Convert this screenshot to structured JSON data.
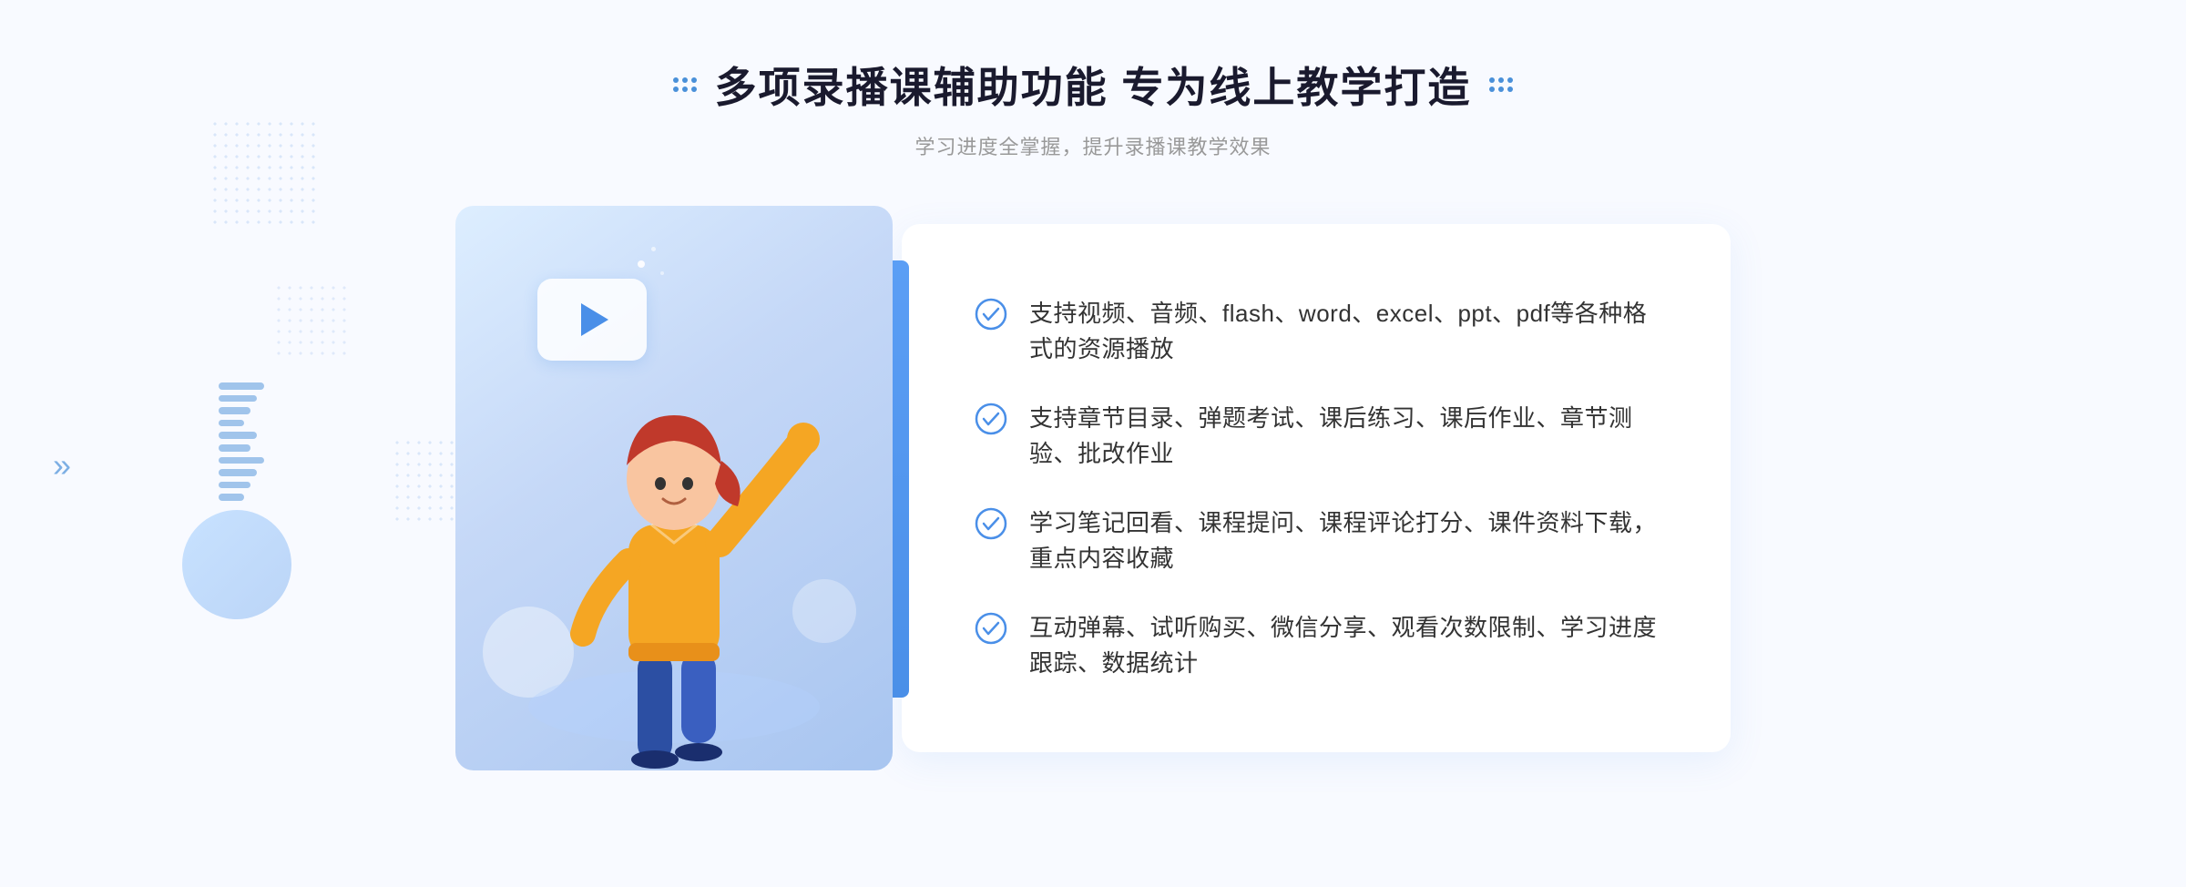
{
  "header": {
    "title": "多项录播课辅助功能 专为线上教学打造",
    "subtitle": "学习进度全掌握，提升录播课教学效果",
    "title_left_dots": "decorative",
    "title_right_dots": "decorative"
  },
  "features": [
    {
      "id": 1,
      "text": "支持视频、音频、flash、word、excel、ppt、pdf等各种格式的资源播放"
    },
    {
      "id": 2,
      "text": "支持章节目录、弹题考试、课后练习、课后作业、章节测验、批改作业"
    },
    {
      "id": 3,
      "text": "学习笔记回看、课程提问、课程评论打分、课件资料下载，重点内容收藏"
    },
    {
      "id": 4,
      "text": "互动弹幕、试听购买、微信分享、观看次数限制、学习进度跟踪、数据统计"
    }
  ],
  "colors": {
    "primary_blue": "#4a8fe8",
    "light_blue": "#ddeeff",
    "title_color": "#1a1a2e",
    "text_color": "#333333",
    "subtitle_color": "#999999"
  },
  "decorations": {
    "arrow_symbol": "»",
    "play_button": "▶"
  }
}
